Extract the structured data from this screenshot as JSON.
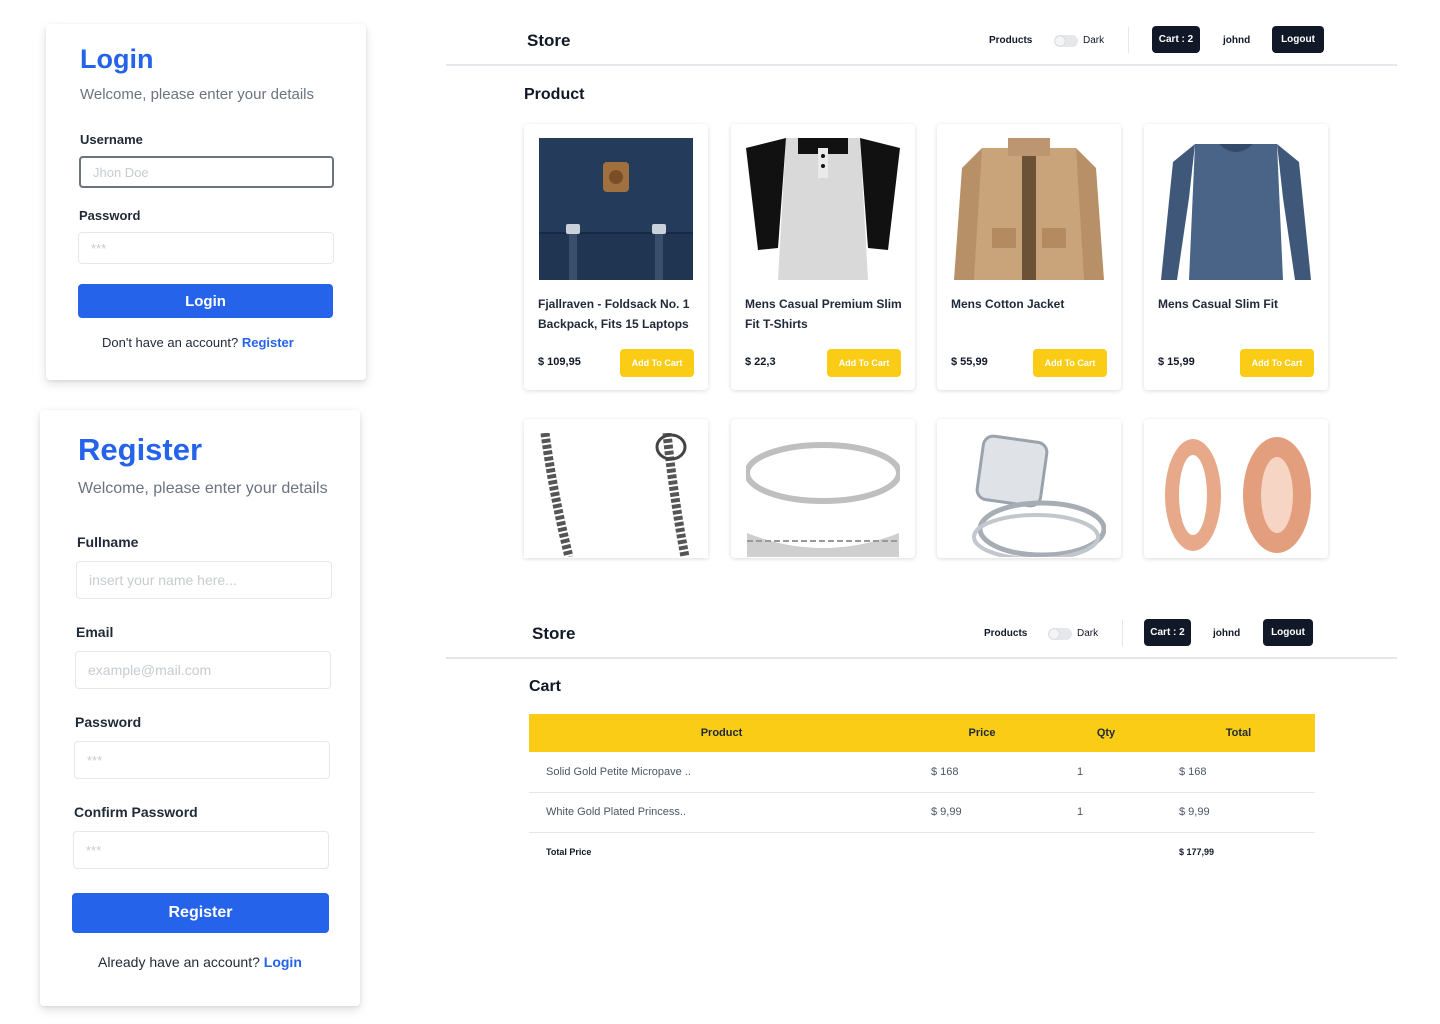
{
  "login": {
    "title": "Login",
    "subtitle": "Welcome, please enter your details",
    "username_label": "Username",
    "username_placeholder": "Jhon Doe",
    "password_label": "Password",
    "password_placeholder": "***",
    "submit_label": "Login",
    "switch_text": "Don't have an account?",
    "switch_link": "Register"
  },
  "register": {
    "title": "Register",
    "subtitle": "Welcome, please enter your details",
    "fullname_label": "Fullname",
    "fullname_placeholder": "insert your name here...",
    "email_label": "Email",
    "email_placeholder": "example@mail.com",
    "password_label": "Password",
    "password_placeholder": "***",
    "confirm_label": "Confirm Password",
    "confirm_placeholder": "***",
    "submit_label": "Register",
    "switch_text": "Already have an account?",
    "switch_link": "Login"
  },
  "header": {
    "brand": "Store",
    "products_link": "Products",
    "dark_label": "Dark",
    "cart_label": "Cart : 2",
    "username": "johnd",
    "logout_label": "Logout"
  },
  "products_page": {
    "title": "Product",
    "add_label": "Add To Cart",
    "items": [
      {
        "name": "Fjallraven - Foldsack No. 1 Backpack, Fits 15 Laptops",
        "price": "$ 109,95"
      },
      {
        "name": "Mens Casual Premium Slim Fit T-Shirts",
        "price": "$ 22,3"
      },
      {
        "name": "Mens Cotton Jacket",
        "price": "$ 55,99"
      },
      {
        "name": "Mens Casual Slim Fit",
        "price": "$ 15,99"
      }
    ]
  },
  "cart_page": {
    "title": "Cart",
    "columns": [
      "Product",
      "Price",
      "Qty",
      "Total"
    ],
    "rows": [
      {
        "product": "Solid Gold Petite Micropave ..",
        "price": "$ 168",
        "qty": "1",
        "total": "$ 168"
      },
      {
        "product": "White Gold Plated Princess..",
        "price": "$ 9,99",
        "qty": "1",
        "total": "$ 9,99"
      }
    ],
    "total_label": "Total Price",
    "total_value": "$ 177,99"
  },
  "colors": {
    "primary": "#2563eb",
    "accent": "#facc15",
    "dark": "#111827"
  }
}
